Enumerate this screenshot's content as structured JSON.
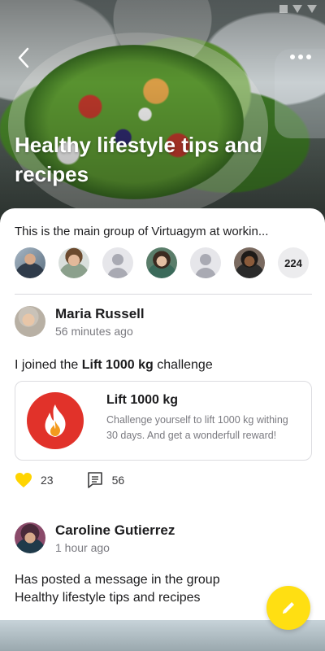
{
  "header": {
    "title": "Healthy lifestyle tips and recipes",
    "back_icon": "chevron-left-icon",
    "more_icon": "more-horizontal-icon"
  },
  "group": {
    "description": "This is the main group of Virtuagym at workin...",
    "member_count": "224"
  },
  "posts": [
    {
      "author": "Maria Russell",
      "time": "56 minutes ago",
      "text_prefix": "I joined the ",
      "text_bold": "Lift 1000 kg",
      "text_suffix": " challenge",
      "challenge": {
        "title": "Lift 1000 kg",
        "description": "Challenge yourself to lift 1000 kg withing 30 days. And get a wonderfull reward!",
        "icon": "flame-icon"
      },
      "likes": "23",
      "comments": "56"
    },
    {
      "author": "Caroline Gutierrez",
      "time": "1 hour ago",
      "text_line1": "Has posted a message in the group",
      "text_line2": "Healthy lifestyle tips and recipes"
    }
  ],
  "colors": {
    "accent_yellow": "#ffdf12",
    "challenge_red": "#e1322a"
  },
  "fab": {
    "icon": "pencil-icon"
  }
}
